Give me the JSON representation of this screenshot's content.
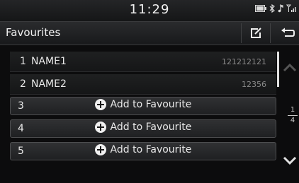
{
  "status_bar": {
    "time": "11:29"
  },
  "header": {
    "title": "Favourites"
  },
  "favourites": [
    {
      "index": "1",
      "name": "NAME1",
      "number": "121212121"
    },
    {
      "index": "2",
      "name": "NAME2",
      "number": "12356"
    }
  ],
  "empty_slots": [
    {
      "index": "3",
      "label": "Add to Favourite"
    },
    {
      "index": "4",
      "label": "Add to Favourite"
    },
    {
      "index": "5",
      "label": "Add to Favourite"
    }
  ],
  "pagination": {
    "current": "1",
    "total": "4"
  }
}
